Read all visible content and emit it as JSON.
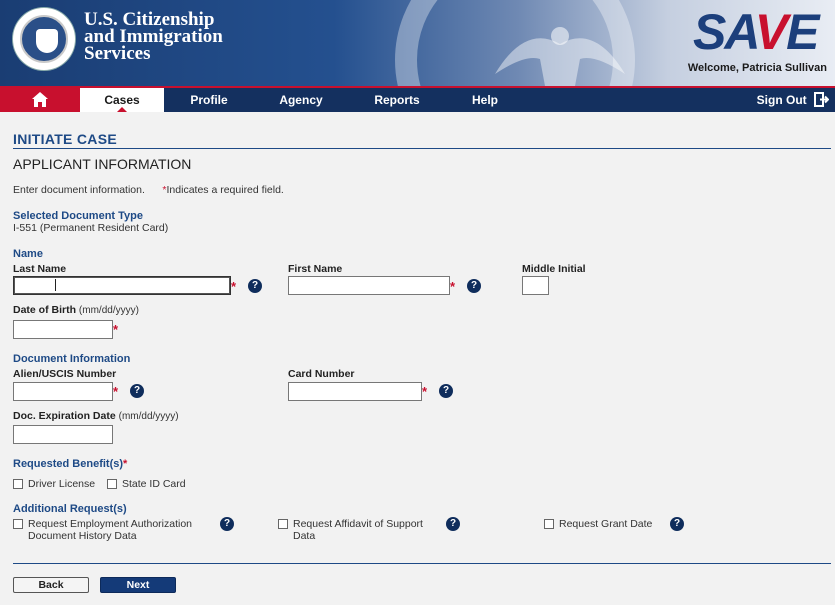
{
  "header": {
    "agency_line1": "U.S. Citizenship",
    "agency_line2": "and Immigration",
    "agency_line3": "Services",
    "logo_part1": "SA",
    "logo_part2": "V",
    "logo_part3": "E",
    "welcome": "Welcome, Patricia Sullivan"
  },
  "nav": {
    "tabs": [
      {
        "label": "Cases",
        "active": true
      },
      {
        "label": "Profile"
      },
      {
        "label": "Agency"
      },
      {
        "label": "Reports"
      },
      {
        "label": "Help"
      }
    ],
    "sign_out": "Sign Out"
  },
  "page": {
    "title": "INITIATE CASE",
    "section": "APPLICANT INFORMATION",
    "instructions": "Enter document information.",
    "required_note_star": "*",
    "required_note": "Indicates a required field."
  },
  "document_type": {
    "heading": "Selected Document Type",
    "value": "I-551 (Permanent Resident Card)"
  },
  "name": {
    "heading": "Name",
    "last_name_label": "Last Name",
    "first_name_label": "First Name",
    "middle_initial_label": "Middle Initial",
    "last_name_value": "",
    "first_name_value": "",
    "middle_initial_value": ""
  },
  "dob": {
    "label": "Date of Birth",
    "hint": "(mm/dd/yyyy)",
    "value": ""
  },
  "document_info": {
    "heading": "Document Information",
    "alien_label": "Alien/USCIS Number",
    "card_label": "Card Number",
    "expiration_label": "Doc. Expiration Date",
    "expiration_hint": "(mm/dd/yyyy)",
    "alien_value": "",
    "card_value": "",
    "expiration_value": ""
  },
  "benefits": {
    "heading": "Requested Benefit(s)",
    "star": "*",
    "options": [
      "Driver License",
      "State ID Card"
    ]
  },
  "additional": {
    "heading": "Additional Request(s)",
    "options": [
      {
        "line1": "Request Employment Authorization",
        "line2": "Document History Data"
      },
      {
        "line1": "Request Affidavit of Support",
        "line2": "Data"
      },
      {
        "line1": "Request Grant Date",
        "line2": ""
      }
    ]
  },
  "buttons": {
    "back": "Back",
    "next": "Next"
  },
  "help_glyph": "?",
  "required_star": "*",
  "colors": {
    "brand_blue": "#1e4a86",
    "nav_blue": "#14305f",
    "accent_red": "#c8102e"
  }
}
